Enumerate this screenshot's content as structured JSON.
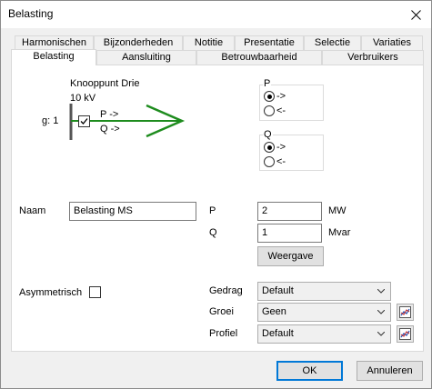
{
  "window": {
    "title": "Belasting"
  },
  "tabs_row1": [
    "Harmonischen",
    "Bijzonderheden",
    "Notitie",
    "Presentatie",
    "Selectie",
    "Variaties"
  ],
  "tabs_row2": [
    "Belasting",
    "Aansluiting",
    "Betrouwbaarheid",
    "Verbruikers"
  ],
  "diagram": {
    "node_name": "Knooppunt Drie",
    "voltage": "10 kV",
    "g_label": "g: 1",
    "p_arrow": "P ->",
    "q_arrow": "Q ->",
    "line_color": "#1e8c1e"
  },
  "p_group": {
    "title": "P",
    "option_forward": "->",
    "option_back": "<-",
    "selected": "forward"
  },
  "q_group": {
    "title": "Q",
    "option_forward": "->",
    "option_back": "<-",
    "selected": "forward"
  },
  "form": {
    "naam_label": "Naam",
    "naam_value": "Belasting MS",
    "p_label": "P",
    "p_value": "2",
    "p_unit": "MW",
    "q_label": "Q",
    "q_value": "1",
    "q_unit": "Mvar",
    "weergave_label": "Weergave",
    "asym_label": "Asymmetrisch",
    "asym_checked": false,
    "gedrag_label": "Gedrag",
    "gedrag_value": "Default",
    "groei_label": "Groei",
    "groei_value": "Geen",
    "profiel_label": "Profiel",
    "profiel_value": "Default"
  },
  "buttons": {
    "ok": "OK",
    "cancel": "Annuleren"
  }
}
